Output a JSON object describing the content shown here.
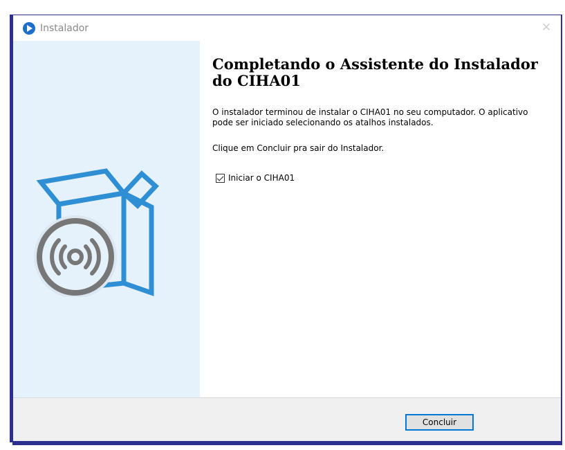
{
  "window": {
    "title": "Instalador",
    "close_glyph": "✕"
  },
  "content": {
    "heading": "Completando o Assistente do Instalador do CIHA01",
    "paragraph1": "O instalador terminou de instalar o CIHA01 no seu computador. O aplicativo pode ser iniciado selecionando os atalhos instalados.",
    "paragraph2": "Clique em Concluir pra sair do Instalador.",
    "launch_checkbox": {
      "label": "Iniciar o CIHA01",
      "checked": true
    }
  },
  "footer": {
    "finish_label": "Concluir"
  },
  "icons": {
    "app": "installer-app-icon",
    "illustration": "box-with-disc-icon"
  },
  "colors": {
    "accent": "#0078d7",
    "side_panel": "#e5f1fb",
    "box_stroke": "#2f8fd5",
    "disc_stroke": "#777777"
  }
}
